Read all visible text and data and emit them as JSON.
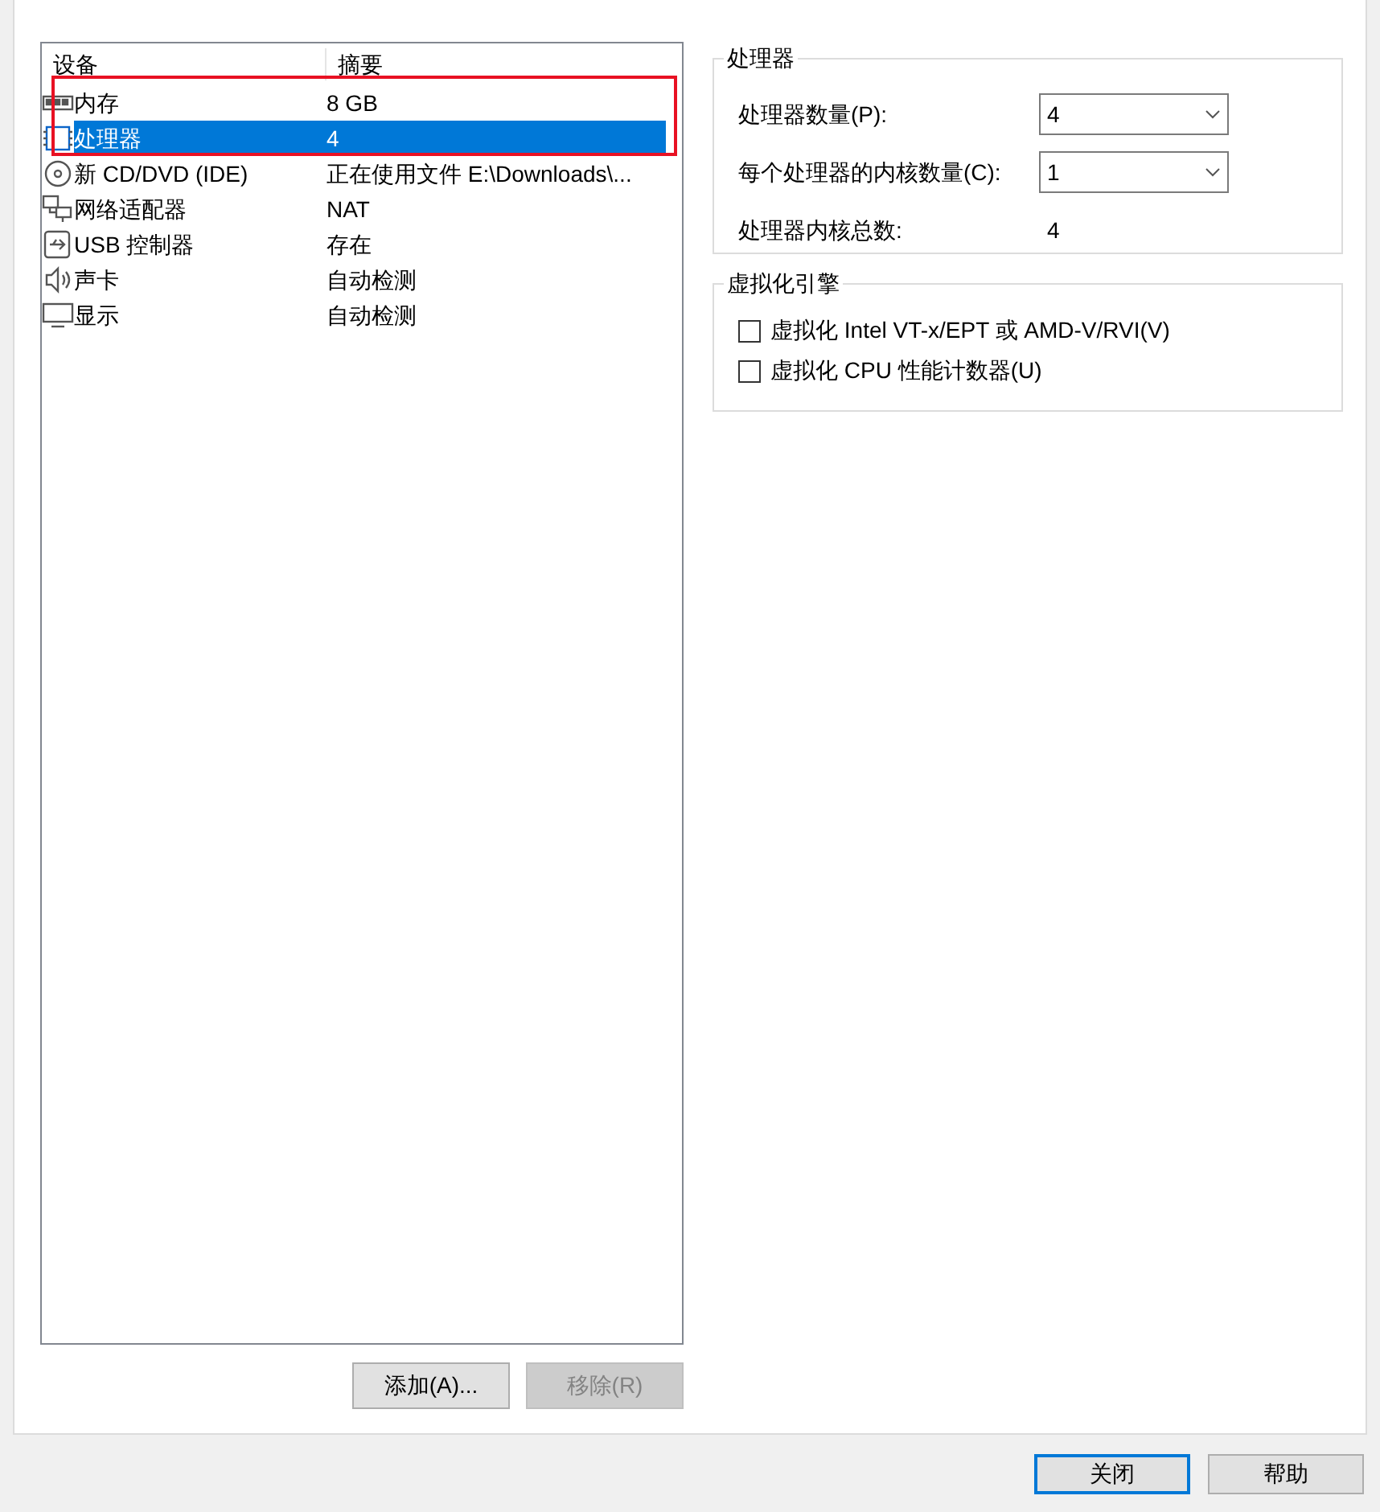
{
  "devices": {
    "columns": [
      "设备",
      "摘要"
    ],
    "rows": [
      {
        "kind": "memory",
        "name": "内存",
        "summary": "8 GB",
        "selected": false
      },
      {
        "kind": "cpu",
        "name": "处理器",
        "summary": "4",
        "selected": true
      },
      {
        "kind": "cdrom",
        "name": "新 CD/DVD (IDE)",
        "summary": "正在使用文件 E:\\Downloads\\...",
        "selected": false
      },
      {
        "kind": "network",
        "name": "网络适配器",
        "summary": "NAT",
        "selected": false
      },
      {
        "kind": "usb",
        "name": "USB 控制器",
        "summary": "存在",
        "selected": false
      },
      {
        "kind": "sound",
        "name": "声卡",
        "summary": "自动检测",
        "selected": false
      },
      {
        "kind": "display",
        "name": "显示",
        "summary": "自动检测",
        "selected": false
      }
    ],
    "buttons": [
      {
        "label": "添加(A)...",
        "disabled": false
      },
      {
        "label": "移除(R)",
        "disabled": true
      }
    ]
  },
  "processors": {
    "title": "处理器",
    "fields": [
      {
        "kind": "select",
        "label": "处理器数量(P):",
        "value": "4"
      },
      {
        "kind": "select",
        "label": "每个处理器的内核数量(C):",
        "value": "1"
      },
      {
        "kind": "text",
        "label": "处理器内核总数:",
        "value": "4"
      }
    ]
  },
  "virtualization": {
    "title": "虚拟化引擎",
    "options": [
      {
        "label": "虚拟化 Intel VT-x/EPT 或 AMD-V/RVI(V)",
        "checked": false
      },
      {
        "label": "虚拟化 CPU 性能计数器(U)",
        "checked": false
      }
    ]
  },
  "footer_buttons": [
    {
      "label": "关闭",
      "default": true
    },
    {
      "label": "帮助",
      "default": false
    }
  ]
}
